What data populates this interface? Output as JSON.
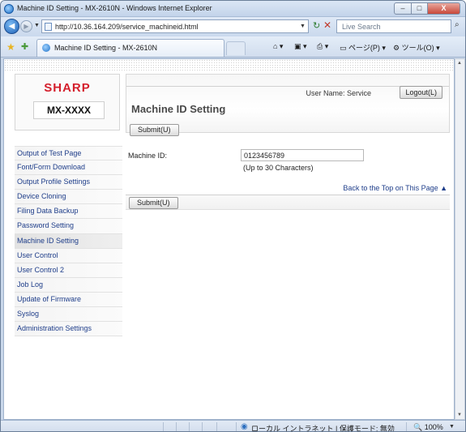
{
  "window": {
    "title": "Machine ID Setting - MX-2610N - Windows Internet Explorer",
    "min": "–",
    "max": "□",
    "close": "X"
  },
  "address": {
    "url": "http://10.36.164.209/service_machineid.html",
    "search_placeholder": "Live Search"
  },
  "tab": {
    "title": "Machine ID Setting - MX-2610N"
  },
  "commands": {
    "page": "ページ(P)",
    "tools": "ツール(O)"
  },
  "brand": {
    "logo": "SHARP",
    "model": "MX-XXXX",
    "color": "#d41f2c"
  },
  "sidebar": {
    "items": [
      {
        "label": "Output of Test Page"
      },
      {
        "label": "Font/Form Download"
      },
      {
        "label": "Output Profile Settings"
      },
      {
        "label": "Device Cloning"
      },
      {
        "label": "Filing Data Backup"
      },
      {
        "label": "Password Setting"
      },
      {
        "label": "Machine ID Setting"
      },
      {
        "label": "User Control"
      },
      {
        "label": "User Control 2"
      },
      {
        "label": "Job Log"
      },
      {
        "label": "Update of Firmware"
      },
      {
        "label": "Syslog"
      },
      {
        "label": "Administration Settings"
      }
    ],
    "active_index": 6
  },
  "header": {
    "user_name": "User Name: Service",
    "logout": "Logout(L)"
  },
  "main": {
    "title": "Machine ID Setting",
    "submit": "Submit(U)",
    "field_label": "Machine ID:",
    "field_value": "0123456789",
    "field_hint": "(Up to 30 Characters)",
    "back_to_top": "Back to the Top on This Page ▲"
  },
  "status": {
    "zone": "ローカル イントラネット | 保護モード: 無効",
    "zoom": "100%"
  }
}
